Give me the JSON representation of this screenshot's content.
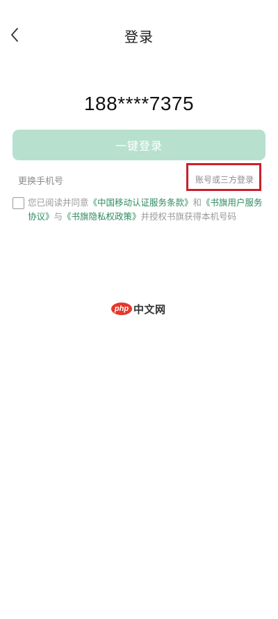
{
  "header": {
    "title": "登录"
  },
  "phone_number": "188****7375",
  "primary_button": {
    "label": "一键登录"
  },
  "links": {
    "change_phone": "更换手机号",
    "account_login": "账号或三方登录"
  },
  "agreement": {
    "prefix": "您已阅读并同意",
    "link1": "《中国移动认证服务条款》",
    "and": "和",
    "link2": "《书旗用户服务协议》",
    "with": "与",
    "link3": "《书旗隐私权政策》",
    "suffix": "并授权书旗获得本机号码"
  },
  "watermark": {
    "logo_text": "php",
    "text": "中文网"
  },
  "colors": {
    "primary_disabled": "#b7e0cf",
    "link_green": "#2c8a5f",
    "highlight_red": "#c8202c"
  },
  "icons": {
    "back": "chevron-left-icon",
    "checkbox": "checkbox-unchecked-icon"
  }
}
